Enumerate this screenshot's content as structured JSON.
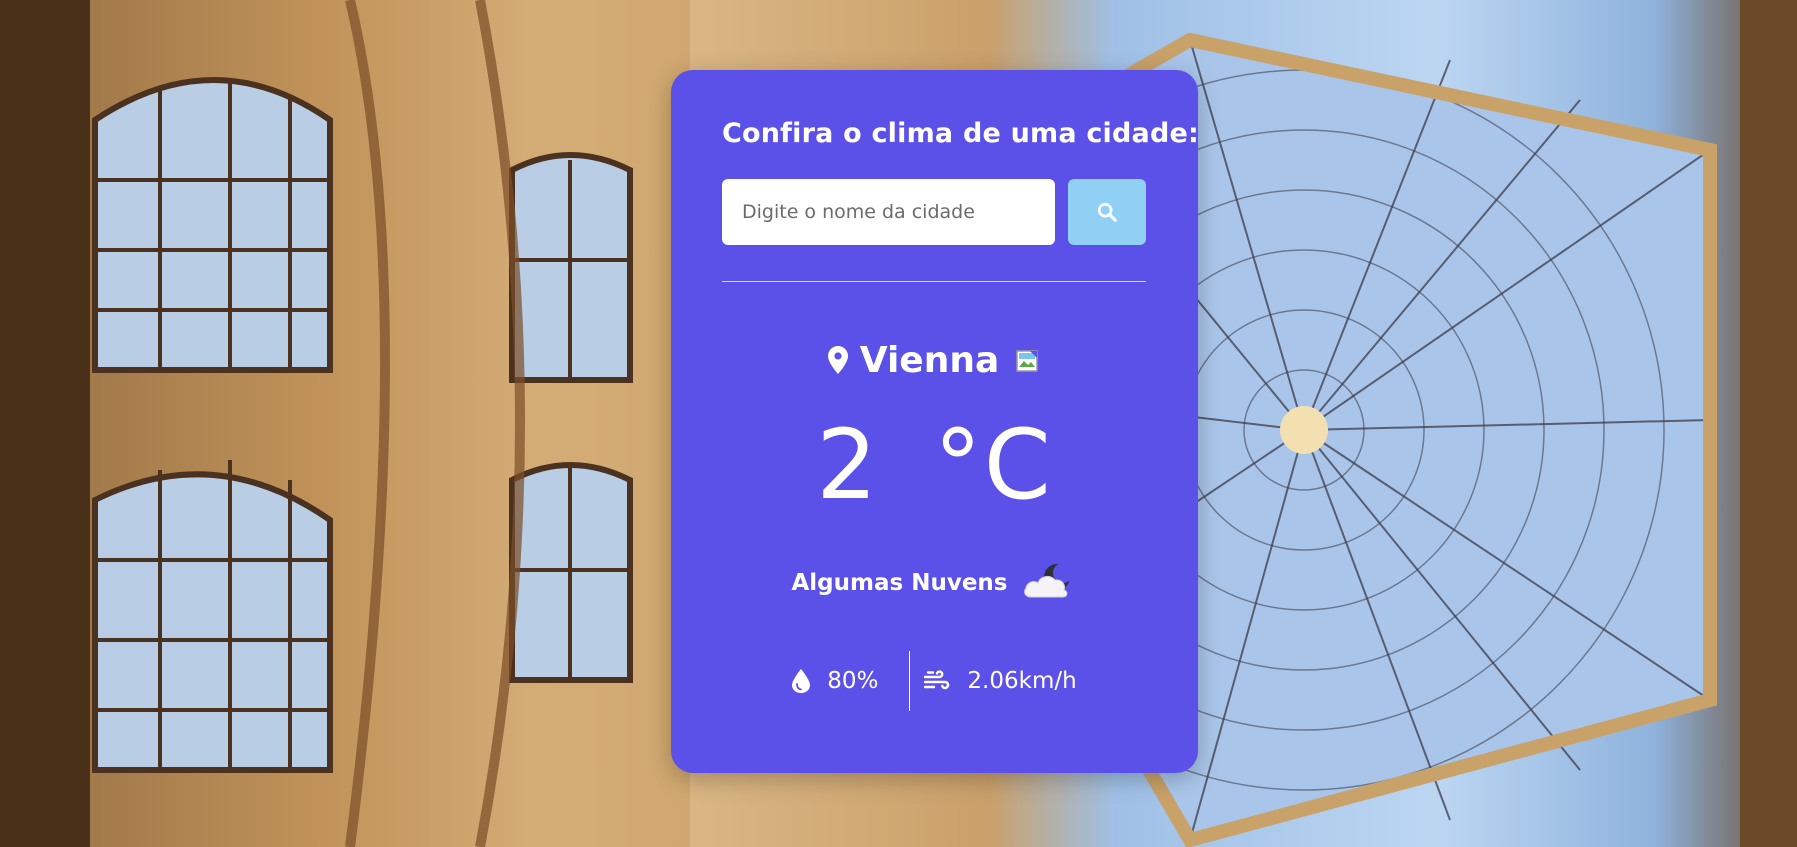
{
  "search": {
    "title": "Confira o clima de uma cidade:",
    "placeholder": "Digite o nome da cidade",
    "value": ""
  },
  "weather": {
    "city": "Vienna",
    "temperature": "2",
    "unit": "°C",
    "description": "Algumas Nuvens",
    "humidity": "80%",
    "wind": "2.06km/h"
  },
  "colors": {
    "card_background": "#5b51e9",
    "search_button": "#8fd0f4",
    "text": "#ffffff"
  },
  "icons": {
    "search": "search-icon",
    "location": "map-pin-icon",
    "flag": "broken-image-icon",
    "weather": "cloudy-night-icon",
    "humidity": "droplet-icon",
    "wind": "wind-icon"
  }
}
